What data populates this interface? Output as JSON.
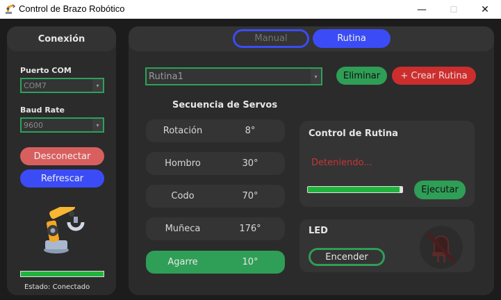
{
  "window": {
    "title": "Control de Brazo Robótico",
    "minimize_glyph": "—",
    "maximize_glyph": "☐",
    "close_glyph": "✕"
  },
  "sidebar": {
    "title": "Conexión",
    "port_label": "Puerto COM",
    "port_value": "COM7",
    "baud_label": "Baud Rate",
    "baud_value": "9600",
    "disconnect_label": "Desconectar",
    "refresh_label": "Refrescar",
    "connection_progress": 1.0,
    "status_text": "Estado: Conectado"
  },
  "tabs": [
    {
      "label": "Manual",
      "active": false
    },
    {
      "label": "Rutina",
      "active": true
    }
  ],
  "routine": {
    "selected": "Rutina1",
    "delete_label": "Eliminar",
    "create_label": "+ Crear Rutina"
  },
  "sequence": {
    "title": "Secuencia de Servos",
    "servos": [
      {
        "name": "Rotación",
        "value": "8°",
        "active": false
      },
      {
        "name": "Hombro",
        "value": "30°",
        "active": false
      },
      {
        "name": "Codo",
        "value": "70°",
        "active": false
      },
      {
        "name": "Muñeca",
        "value": "176°",
        "active": false
      },
      {
        "name": "Agarre",
        "value": "10°",
        "active": true
      }
    ]
  },
  "routine_control": {
    "title": "Control de Rutina",
    "status": "Deteniendo...",
    "progress": 0.97,
    "run_label": "Ejecutar"
  },
  "led": {
    "title": "LED",
    "toggle_label": "Encender",
    "icon": "light-off-icon"
  },
  "colors": {
    "accent_blue": "#3b4cf6",
    "accent_green": "#2f9e56",
    "danger_red": "#cc2e2e",
    "progress_green": "#21b43d"
  },
  "arrow_glyph": "▾"
}
